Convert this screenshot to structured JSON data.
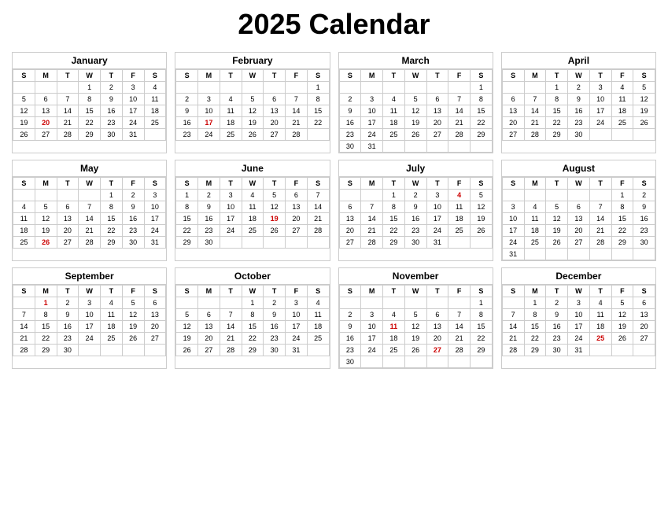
{
  "title": "2025 Calendar",
  "months": [
    {
      "name": "January",
      "weeks": [
        [
          "",
          "",
          "",
          "1",
          "2",
          "3",
          "4"
        ],
        [
          "5",
          "6",
          "7",
          "8",
          "9",
          "10",
          "11"
        ],
        [
          "12",
          "13",
          "14",
          "15",
          "16",
          "17",
          "18"
        ],
        [
          "19",
          "20",
          "21",
          "22",
          "23",
          "24",
          "25"
        ],
        [
          "26",
          "27",
          "28",
          "29",
          "30",
          "31",
          ""
        ]
      ],
      "reds": [
        "20"
      ]
    },
    {
      "name": "February",
      "weeks": [
        [
          "",
          "",
          "",
          "",
          "",
          "",
          "1"
        ],
        [
          "2",
          "3",
          "4",
          "5",
          "6",
          "7",
          "8"
        ],
        [
          "9",
          "10",
          "11",
          "12",
          "13",
          "14",
          "15"
        ],
        [
          "16",
          "17",
          "18",
          "19",
          "20",
          "21",
          "22"
        ],
        [
          "23",
          "24",
          "25",
          "26",
          "27",
          "28",
          ""
        ]
      ],
      "reds": [
        "17"
      ]
    },
    {
      "name": "March",
      "weeks": [
        [
          "",
          "",
          "",
          "",
          "",
          "",
          "1"
        ],
        [
          "2",
          "3",
          "4",
          "5",
          "6",
          "7",
          "8"
        ],
        [
          "9",
          "10",
          "11",
          "12",
          "13",
          "14",
          "15"
        ],
        [
          "16",
          "17",
          "18",
          "19",
          "20",
          "21",
          "22"
        ],
        [
          "23",
          "24",
          "25",
          "26",
          "27",
          "28",
          "29"
        ],
        [
          "30",
          "31",
          "",
          "",
          "",
          "",
          ""
        ]
      ],
      "reds": []
    },
    {
      "name": "April",
      "weeks": [
        [
          "",
          "",
          "1",
          "2",
          "3",
          "4",
          "5"
        ],
        [
          "6",
          "7",
          "8",
          "9",
          "10",
          "11",
          "12"
        ],
        [
          "13",
          "14",
          "15",
          "16",
          "17",
          "18",
          "19"
        ],
        [
          "20",
          "21",
          "22",
          "23",
          "24",
          "25",
          "26"
        ],
        [
          "27",
          "28",
          "29",
          "30",
          "",
          "",
          ""
        ]
      ],
      "reds": []
    },
    {
      "name": "May",
      "weeks": [
        [
          "",
          "",
          "",
          "",
          "1",
          "2",
          "3"
        ],
        [
          "4",
          "5",
          "6",
          "7",
          "8",
          "9",
          "10"
        ],
        [
          "11",
          "12",
          "13",
          "14",
          "15",
          "16",
          "17"
        ],
        [
          "18",
          "19",
          "20",
          "21",
          "22",
          "23",
          "24"
        ],
        [
          "25",
          "26",
          "27",
          "28",
          "29",
          "30",
          "31"
        ]
      ],
      "reds": [
        "26"
      ]
    },
    {
      "name": "June",
      "weeks": [
        [
          "1",
          "2",
          "3",
          "4",
          "5",
          "6",
          "7"
        ],
        [
          "8",
          "9",
          "10",
          "11",
          "12",
          "13",
          "14"
        ],
        [
          "15",
          "16",
          "17",
          "18",
          "19",
          "20",
          "21"
        ],
        [
          "22",
          "23",
          "24",
          "25",
          "26",
          "27",
          "28"
        ],
        [
          "29",
          "30",
          "",
          "",
          "",
          "",
          ""
        ]
      ],
      "reds": [
        "19"
      ]
    },
    {
      "name": "July",
      "weeks": [
        [
          "",
          "",
          "1",
          "2",
          "3",
          "4",
          "5"
        ],
        [
          "6",
          "7",
          "8",
          "9",
          "10",
          "11",
          "12"
        ],
        [
          "13",
          "14",
          "15",
          "16",
          "17",
          "18",
          "19"
        ],
        [
          "20",
          "21",
          "22",
          "23",
          "24",
          "25",
          "26"
        ],
        [
          "27",
          "28",
          "29",
          "30",
          "31",
          "",
          ""
        ]
      ],
      "reds": [
        "4"
      ]
    },
    {
      "name": "August",
      "weeks": [
        [
          "",
          "",
          "",
          "",
          "",
          "1",
          "2"
        ],
        [
          "3",
          "4",
          "5",
          "6",
          "7",
          "8",
          "9"
        ],
        [
          "10",
          "11",
          "12",
          "13",
          "14",
          "15",
          "16"
        ],
        [
          "17",
          "18",
          "19",
          "20",
          "21",
          "22",
          "23"
        ],
        [
          "24",
          "25",
          "26",
          "27",
          "28",
          "29",
          "30"
        ],
        [
          "31",
          "",
          "",
          "",
          "",
          "",
          ""
        ]
      ],
      "reds": []
    },
    {
      "name": "September",
      "weeks": [
        [
          "",
          "1",
          "2",
          "3",
          "4",
          "5",
          "6"
        ],
        [
          "7",
          "8",
          "9",
          "10",
          "11",
          "12",
          "13"
        ],
        [
          "14",
          "15",
          "16",
          "17",
          "18",
          "19",
          "20"
        ],
        [
          "21",
          "22",
          "23",
          "24",
          "25",
          "26",
          "27"
        ],
        [
          "28",
          "29",
          "30",
          "",
          "",
          "",
          ""
        ]
      ],
      "reds": [
        "1"
      ]
    },
    {
      "name": "October",
      "weeks": [
        [
          "",
          "",
          "",
          "1",
          "2",
          "3",
          "4"
        ],
        [
          "5",
          "6",
          "7",
          "8",
          "9",
          "10",
          "11"
        ],
        [
          "12",
          "13",
          "14",
          "15",
          "16",
          "17",
          "18"
        ],
        [
          "19",
          "20",
          "21",
          "22",
          "23",
          "24",
          "25"
        ],
        [
          "26",
          "27",
          "28",
          "29",
          "30",
          "31",
          ""
        ]
      ],
      "reds": []
    },
    {
      "name": "November",
      "weeks": [
        [
          "",
          "",
          "",
          "",
          "",
          "",
          "1"
        ],
        [
          "2",
          "3",
          "4",
          "5",
          "6",
          "7",
          "8"
        ],
        [
          "9",
          "10",
          "11",
          "12",
          "13",
          "14",
          "15"
        ],
        [
          "16",
          "17",
          "18",
          "19",
          "20",
          "21",
          "22"
        ],
        [
          "23",
          "24",
          "25",
          "26",
          "27",
          "28",
          "29"
        ],
        [
          "30",
          "",
          "",
          "",
          "",
          "",
          ""
        ]
      ],
      "reds": [
        "11",
        "27"
      ]
    },
    {
      "name": "December",
      "weeks": [
        [
          "",
          "1",
          "2",
          "3",
          "4",
          "5",
          "6"
        ],
        [
          "7",
          "8",
          "9",
          "10",
          "11",
          "12",
          "13"
        ],
        [
          "14",
          "15",
          "16",
          "17",
          "18",
          "19",
          "20"
        ],
        [
          "21",
          "22",
          "23",
          "24",
          "25",
          "26",
          "27"
        ],
        [
          "28",
          "29",
          "30",
          "31",
          "",
          "",
          ""
        ]
      ],
      "reds": [
        "25"
      ]
    }
  ],
  "dayHeaders": [
    "S",
    "M",
    "T",
    "W",
    "T",
    "F",
    "S"
  ]
}
